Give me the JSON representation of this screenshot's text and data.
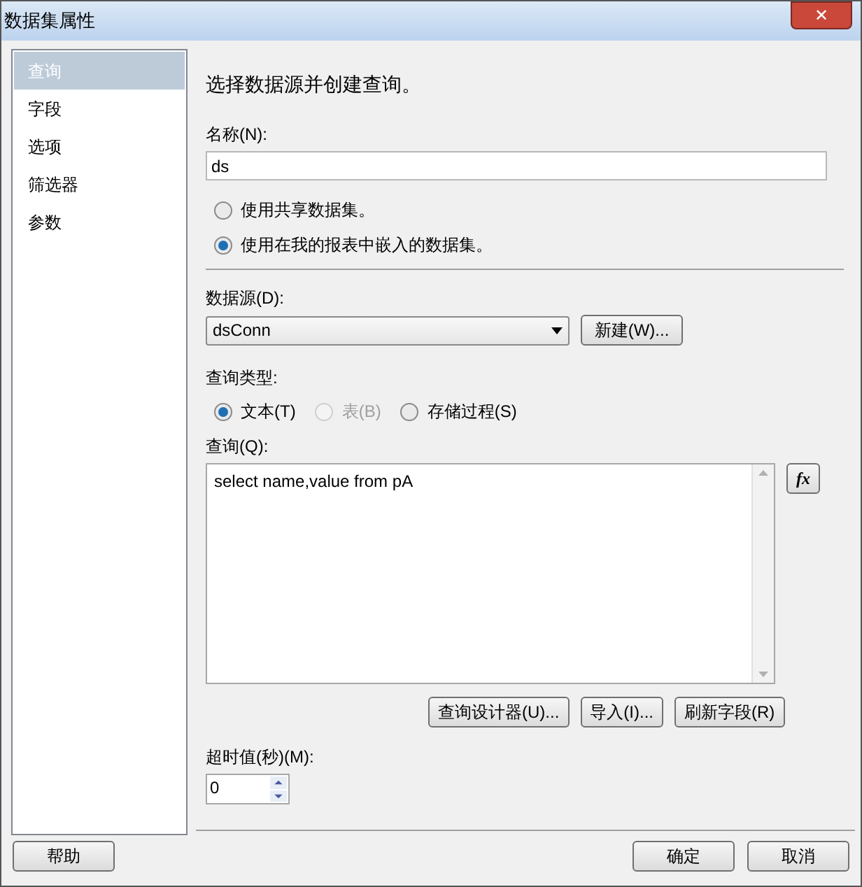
{
  "window": {
    "title": "数据集属性",
    "close": "✕"
  },
  "sidebar": {
    "items": [
      {
        "label": "查询",
        "selected": true
      },
      {
        "label": "字段",
        "selected": false
      },
      {
        "label": "选项",
        "selected": false
      },
      {
        "label": "筛选器",
        "selected": false
      },
      {
        "label": "参数",
        "selected": false
      }
    ]
  },
  "heading": "选择数据源并创建查询。",
  "name_label": "名称(N):",
  "name_value": "ds",
  "dataset_options": [
    {
      "label": "使用共享数据集。",
      "selected": false
    },
    {
      "label": "使用在我的报表中嵌入的数据集。",
      "selected": true
    }
  ],
  "datasource_label": "数据源(D):",
  "datasource_value": "dsConn",
  "new_button": "新建(W)...",
  "query_type_label": "查询类型:",
  "query_types": [
    {
      "label": "文本(T)",
      "selected": true,
      "disabled": false
    },
    {
      "label": "表(B)",
      "selected": false,
      "disabled": true
    },
    {
      "label": "存储过程(S)",
      "selected": false,
      "disabled": false
    }
  ],
  "query_label": "查询(Q):",
  "query_value": "select name,value from pA",
  "fx_button": "fx",
  "query_buttons": [
    "查询设计器(U)...",
    "导入(I)...",
    "刷新字段(R)"
  ],
  "timeout_label": "超时值(秒)(M):",
  "timeout_value": "0",
  "help_button": "帮助",
  "ok_button": "确定",
  "cancel_button": "取消"
}
